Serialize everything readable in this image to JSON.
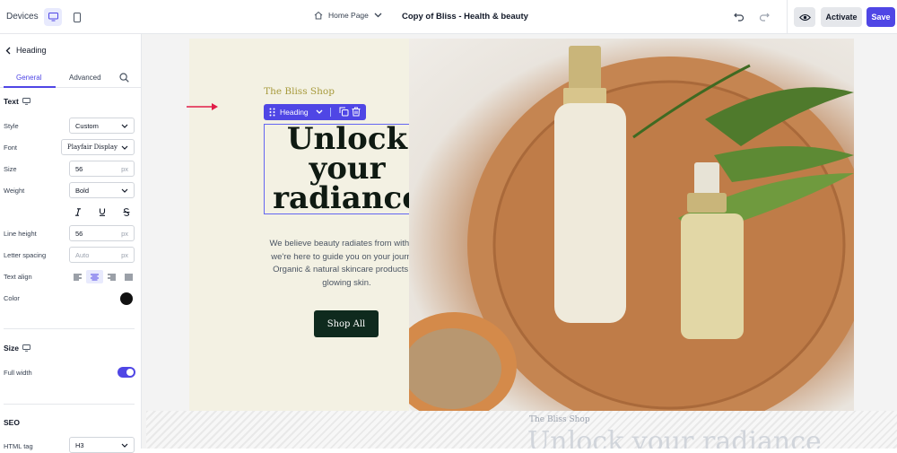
{
  "topbar": {
    "devices_label": "Devices",
    "page_select": "Home Page",
    "doc_title": "Copy of Bliss - Health & beauty",
    "activate_label": "Activate",
    "save_label": "Save"
  },
  "sidebar": {
    "back_label": "Heading",
    "tabs": {
      "general": "General",
      "advanced": "Advanced"
    },
    "text_section": {
      "title": "Text",
      "style_label": "Style",
      "style_value": "Custom",
      "font_label": "Font",
      "font_value": "Playfair Display",
      "size_label": "Size",
      "size_value": "56",
      "size_unit": "px",
      "weight_label": "Weight",
      "weight_value": "Bold",
      "line_height_label": "Line height",
      "line_height_value": "56",
      "line_height_unit": "px",
      "letter_spacing_label": "Letter spacing",
      "letter_spacing_placeholder": "Auto",
      "letter_spacing_unit": "px",
      "text_align_label": "Text align",
      "color_label": "Color",
      "color_value": "#111111"
    },
    "size_section": {
      "title": "Size",
      "full_width_label": "Full width",
      "full_width_on": true
    },
    "seo_section": {
      "title": "SEO",
      "html_tag_label": "HTML tag",
      "html_tag_value": "H3"
    }
  },
  "canvas": {
    "brand": "The Bliss Shop",
    "heading_toolbar_label": "Heading",
    "heading": "Unlock your radiance",
    "body": "We believe beauty radiates from within & we're here to guide you on your journey. Organic & natural skincare products for glowing skin.",
    "shop_button": "Shop All",
    "bottom_brand": "The Bliss Shop",
    "bottom_heading": "Unlock your radiance"
  },
  "colors": {
    "accent": "#4f46e5",
    "hero_bg": "#f3f1e3",
    "button_dark": "#0f2a1e",
    "brand_gold": "#a79a3c"
  }
}
